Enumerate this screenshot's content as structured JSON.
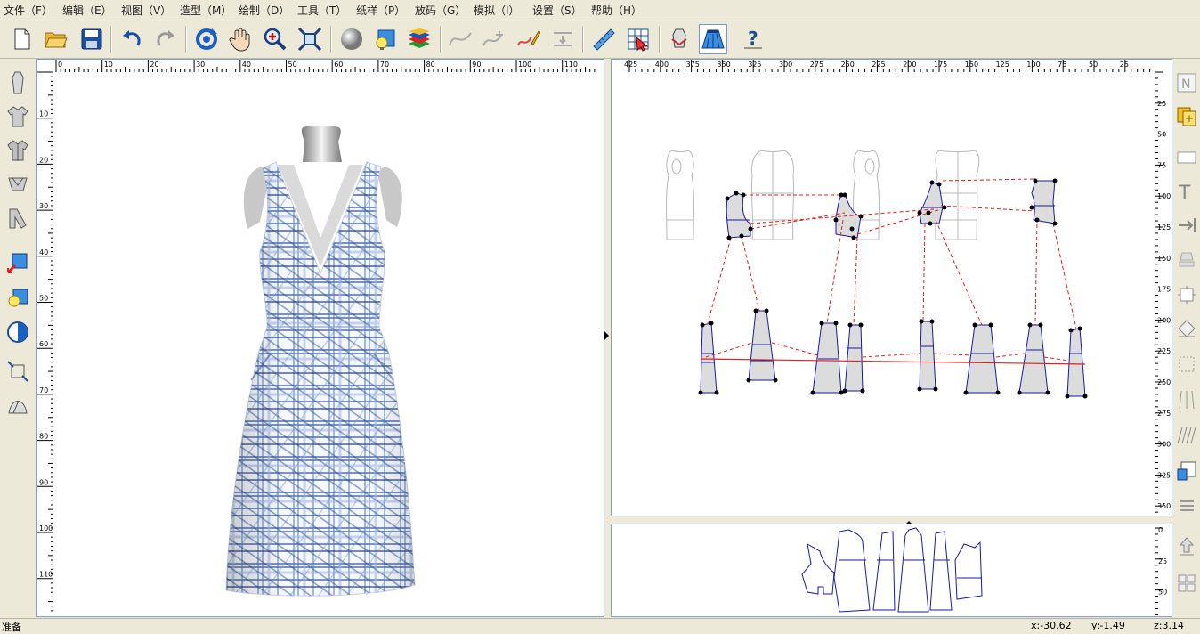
{
  "menu": [
    {
      "label": "文件（F）"
    },
    {
      "label": "编辑（E）"
    },
    {
      "label": "视图（V）"
    },
    {
      "label": "造型（M）"
    },
    {
      "label": "绘制（D）"
    },
    {
      "label": "工具（T）"
    },
    {
      "label": "纸样（P）"
    },
    {
      "label": "放码（G）"
    },
    {
      "label": "模拟（I）"
    },
    {
      "label": "设置（S）"
    },
    {
      "label": "帮助（H）"
    }
  ],
  "toolbar": {
    "icons": [
      "new-file-icon",
      "open-folder-icon",
      "save-icon",
      "undo-icon",
      "redo-icon",
      "rotate-view-icon",
      "pan-hand-icon",
      "zoom-icon",
      "fit-view-icon",
      "sphere-shading-icon",
      "light-bulb-icon",
      "layers-icon",
      "curve-icon",
      "curve-edit-icon",
      "pen-draw-icon",
      "measure-icon",
      "ruler-icon",
      "grid-select-icon",
      "mannequin-pattern-icon",
      "skirt-pattern-icon",
      "help-icon"
    ]
  },
  "left_ruler": {
    "h_ticks": [
      "0",
      "10",
      "20",
      "30",
      "40",
      "50",
      "60",
      "70",
      "80",
      "90",
      "100",
      "110"
    ],
    "v_ticks": [
      "10",
      "20",
      "30",
      "40",
      "50",
      "60",
      "70",
      "80",
      "90",
      "100",
      "110"
    ]
  },
  "right_ruler": {
    "h_ticks": [
      "425",
      "400",
      "375",
      "350",
      "325",
      "300",
      "275",
      "250",
      "225",
      "200",
      "175",
      "150",
      "125",
      "100",
      "75",
      "50",
      "25"
    ],
    "v_ticks": [
      "25",
      "50",
      "75",
      "100",
      "125",
      "150",
      "175",
      "200",
      "225",
      "250",
      "275",
      "300",
      "325",
      "350"
    ]
  },
  "bottom_ruler": {
    "v_ticks": [
      "0",
      "25",
      "50"
    ]
  },
  "status": {
    "ready": "准备",
    "x": "x:-30.62",
    "y": "y:-1.49",
    "z": "z:3.14"
  }
}
